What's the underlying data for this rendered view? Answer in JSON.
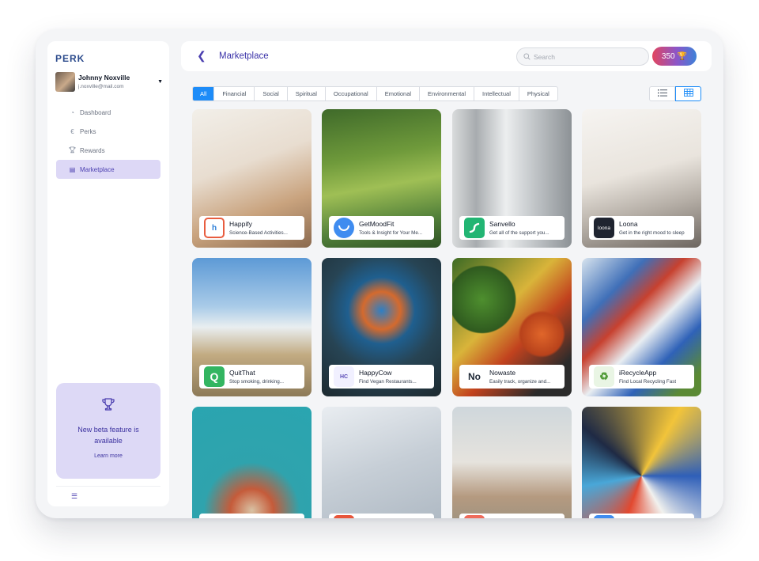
{
  "brand": {
    "logo": "PERK"
  },
  "user": {
    "name": "Johnny Noxville",
    "email": "j.noxville@mail.com"
  },
  "nav": [
    {
      "label": "Dashboard",
      "icon": "dashboard-icon"
    },
    {
      "label": "Perks",
      "icon": "euro-icon"
    },
    {
      "label": "Rewards",
      "icon": "trophy-icon"
    },
    {
      "label": "Marketplace",
      "icon": "store-icon",
      "active": true
    }
  ],
  "beta": {
    "title": "New beta feature is available",
    "link": "Learn more"
  },
  "header": {
    "title": "Marketplace",
    "search_placeholder": "Search",
    "points": "350"
  },
  "filters": [
    "All",
    "Financial",
    "Social",
    "Spiritual",
    "Occupational",
    "Emotional",
    "Environmental",
    "Intellectual",
    "Physical"
  ],
  "active_filter": "All",
  "view": "grid",
  "cards": [
    {
      "title": "Happify",
      "desc": "Science-Based Activities...",
      "logo_text": "h",
      "logo_bg": "#ffffff",
      "logo_fg": "#e85d3f",
      "logo_icon": "happify-logo-icon"
    },
    {
      "title": "GetMoodFit",
      "desc": "Tools & Insight for Your Me...",
      "logo_text": "",
      "logo_bg": "#3f8cf0",
      "logo_fg": "#ffffff",
      "logo_icon": "getmoodfit-logo-icon"
    },
    {
      "title": "Sanvello",
      "desc": "Get all of the support you...",
      "logo_text": "~",
      "logo_bg": "#22b573",
      "logo_fg": "#ffffff",
      "logo_icon": "sanvello-logo-icon"
    },
    {
      "title": "Loona",
      "desc": "Get in the right mood to sleep",
      "logo_text": "loona",
      "logo_bg": "#1f2430",
      "logo_fg": "#ffffff",
      "logo_icon": "loona-logo-icon"
    },
    {
      "title": "QuitThat",
      "desc": "Stop smoking, drinking...",
      "logo_text": "Q",
      "logo_bg": "#33b561",
      "logo_fg": "#ffffff",
      "logo_icon": "quitthat-logo-icon"
    },
    {
      "title": "HappyCow",
      "desc": "Find Vegan Restaurants...",
      "logo_text": "HC",
      "logo_bg": "#f1f0ff",
      "logo_fg": "#5b4bb7",
      "logo_icon": "happycow-logo-icon"
    },
    {
      "title": "Nowaste",
      "desc": "Easily track, organize and...",
      "logo_text": "No",
      "logo_bg": "#ffffff",
      "logo_fg": "#1f2937",
      "logo_icon": "nowaste-logo-icon"
    },
    {
      "title": "iRecycleApp",
      "desc": "Find Local Recycling Fast",
      "logo_text": "♻",
      "logo_bg": "#e9f5e4",
      "logo_fg": "#4f9a36",
      "logo_icon": "irecycle-logo-icon"
    },
    {
      "title": "",
      "desc": "",
      "logo_text": "",
      "logo_bg": "#ffffff",
      "logo_fg": "#1f2937",
      "logo_icon": "money-app-logo-icon"
    },
    {
      "title": "",
      "desc": "",
      "logo_text": "",
      "logo_bg": "#e8553a",
      "logo_fg": "#ffffff",
      "logo_icon": "notes-app-logo-icon"
    },
    {
      "title": "",
      "desc": "",
      "logo_text": "",
      "logo_bg": "#ef6b5b",
      "logo_fg": "#ffffff",
      "logo_icon": "travel-app-logo-icon"
    },
    {
      "title": "",
      "desc": "",
      "logo_text": "",
      "logo_bg": "#3f8cf0",
      "logo_fg": "#ffffff",
      "logo_icon": "art-app-logo-icon"
    }
  ],
  "colors": {
    "accent": "#4b3fb0",
    "filter_active": "#1d8cf8",
    "beta_bg": "#ddd9f6",
    "nav_active_bg": "#ddd8f6"
  }
}
